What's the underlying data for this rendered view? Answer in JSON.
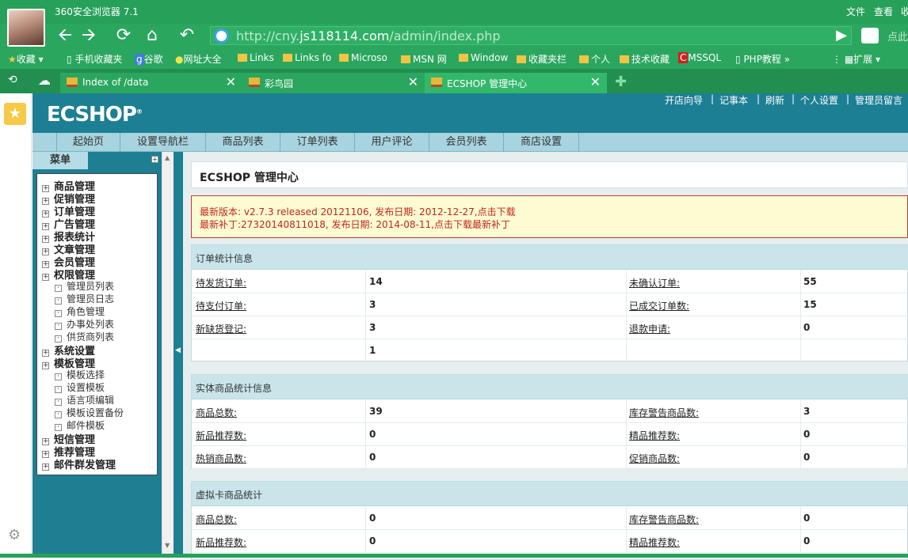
{
  "browser": {
    "title": "360安全浏览器 7.1",
    "menu": [
      "文件",
      "查看",
      "收"
    ],
    "url_prefix": "http://cny.",
    "url_domain": "js118114.com",
    "url_path": "/admin/index.php",
    "right_hint": "点此",
    "bookmarks": [
      "收藏",
      "手机收藏夹",
      "谷歌",
      "网址大全",
      "Links",
      "Links fo",
      "Microso",
      "MSN 网",
      "Window",
      "收藏夹栏",
      "个人",
      "技术收藏",
      "MSSQL",
      "PHP教程",
      "扩展"
    ],
    "tabs": [
      "Index of /data",
      "彩鸟园",
      "ECSHOP 管理中心"
    ]
  },
  "header": {
    "logo": "ECSHOP",
    "links": [
      "开店向导",
      "记事本",
      "刷新",
      "个人设置",
      "管理员留言"
    ]
  },
  "mainnav": [
    "起始页",
    "设置导航栏",
    "商品列表",
    "订单列表",
    "用户评论",
    "会员列表",
    "商店设置"
  ],
  "menu": {
    "title": "菜单",
    "items": [
      {
        "label": "商品管理",
        "sub": false
      },
      {
        "label": "促销管理",
        "sub": false
      },
      {
        "label": "订单管理",
        "sub": false
      },
      {
        "label": "广告管理",
        "sub": false
      },
      {
        "label": "报表统计",
        "sub": false
      },
      {
        "label": "文章管理",
        "sub": false
      },
      {
        "label": "会员管理",
        "sub": false
      },
      {
        "label": "权限管理",
        "sub": false
      },
      {
        "label": "管理员列表",
        "sub": true
      },
      {
        "label": "管理员日志",
        "sub": true
      },
      {
        "label": "角色管理",
        "sub": true
      },
      {
        "label": "办事处列表",
        "sub": true
      },
      {
        "label": "供货商列表",
        "sub": true
      },
      {
        "label": "系统设置",
        "sub": false
      },
      {
        "label": "模板管理",
        "sub": false
      },
      {
        "label": "模板选择",
        "sub": true
      },
      {
        "label": "设置模板",
        "sub": true
      },
      {
        "label": "语言项编辑",
        "sub": true
      },
      {
        "label": "模板设置备份",
        "sub": true
      },
      {
        "label": "邮件模板",
        "sub": true
      },
      {
        "label": "短信管理",
        "sub": false
      },
      {
        "label": "推荐管理",
        "sub": false
      },
      {
        "label": "邮件群发管理",
        "sub": false
      }
    ]
  },
  "content": {
    "title": "ECSHOP 管理中心",
    "notice_line1": "最新版本: v2.7.3 released 20121106, 发布日期: 2012-12-27,点击下载",
    "notice_line2": "最新补丁:27320140811018, 发布日期: 2014-08-11,点击下载最新补丁",
    "order_stats": {
      "title": "订单统计信息",
      "rows": [
        {
          "l1": "待发货订单:",
          "v1": "14",
          "l2": "未确认订单:",
          "v2": "55"
        },
        {
          "l1": "待支付订单:",
          "v1": "3",
          "l2": "已成交订单数:",
          "v2": "15"
        },
        {
          "l1": "新缺货登记:",
          "v1": "3",
          "l2": "退款申请:",
          "v2": "0"
        },
        {
          "l1": "",
          "v1": "1",
          "l2": "",
          "v2": ""
        }
      ]
    },
    "goods_stats": {
      "title": "实体商品统计信息",
      "rows": [
        {
          "l1": "商品总数:",
          "v1": "39",
          "l2": "库存警告商品数:",
          "v2": "3"
        },
        {
          "l1": "新品推荐数:",
          "v1": "0",
          "l2": "精品推荐数:",
          "v2": "0"
        },
        {
          "l1": "热销商品数:",
          "v1": "0",
          "l2": "促销商品数:",
          "v2": "0"
        }
      ]
    },
    "virtual_stats": {
      "title": "虚拟卡商品统计",
      "rows": [
        {
          "l1": "商品总数:",
          "v1": "0",
          "l2": "库存警告商品数:",
          "v2": "0"
        },
        {
          "l1": "新品推荐数:",
          "v1": "0",
          "l2": "精品推荐数:",
          "v2": "0"
        }
      ]
    }
  }
}
